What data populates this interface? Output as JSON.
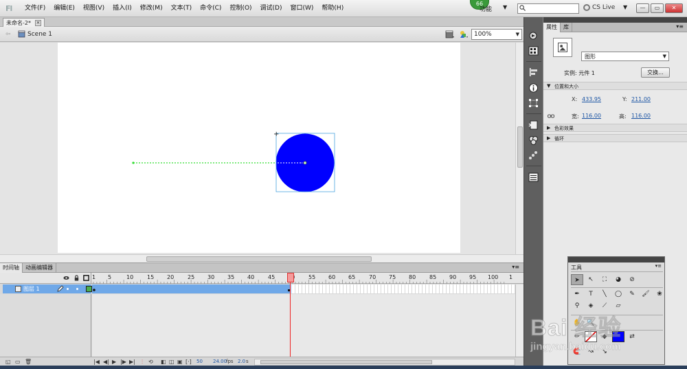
{
  "app": {
    "logo": "Fl",
    "menu": [
      "文件(F)",
      "编辑(E)",
      "视图(V)",
      "插入(I)",
      "修改(M)",
      "文本(T)",
      "命令(C)",
      "控制(O)",
      "调试(D)",
      "窗口(W)",
      "帮助(H)"
    ],
    "notification_count": "66",
    "feature_label": "功能",
    "search_placeholder": "",
    "cslive": "CS Live",
    "window_controls": [
      "—",
      "▭",
      "✕"
    ]
  },
  "document": {
    "tab_label": "未命名-2*",
    "scene_label": "Scene 1",
    "zoom": "100%"
  },
  "stage": {
    "circle_color": "#0000ff",
    "path_color": "#33dd33"
  },
  "timeline": {
    "tabs": [
      "时间轴",
      "动画编辑器"
    ],
    "ruler_labels": [
      "1",
      "5",
      "10",
      "15",
      "20",
      "25",
      "30",
      "35",
      "40",
      "45",
      "50",
      "55",
      "60",
      "65",
      "70",
      "75",
      "80",
      "85",
      "90",
      "95",
      "100",
      "1"
    ],
    "layer_name": "图层 1",
    "current_frame": "50",
    "fps": "24.00",
    "fps_unit": "fps",
    "time": "2.0",
    "time_unit": "s"
  },
  "properties": {
    "tabs": [
      "属性",
      "库"
    ],
    "instance_type": "图形",
    "instance_label": "实例: 元件 1",
    "swap_button": "交换...",
    "section_position": "位置和大小",
    "x_label": "X:",
    "x_value": "433.95",
    "y_label": "Y:",
    "y_value": "211.00",
    "w_label": "宽:",
    "w_value": "116.00",
    "h_label": "高:",
    "h_value": "116.00",
    "section_color": "色彩效果",
    "section_loop": "循环"
  },
  "tools": {
    "title": "工具"
  },
  "watermark": {
    "text": "Bai 经验",
    "url": "jingyan.baidu.com"
  }
}
